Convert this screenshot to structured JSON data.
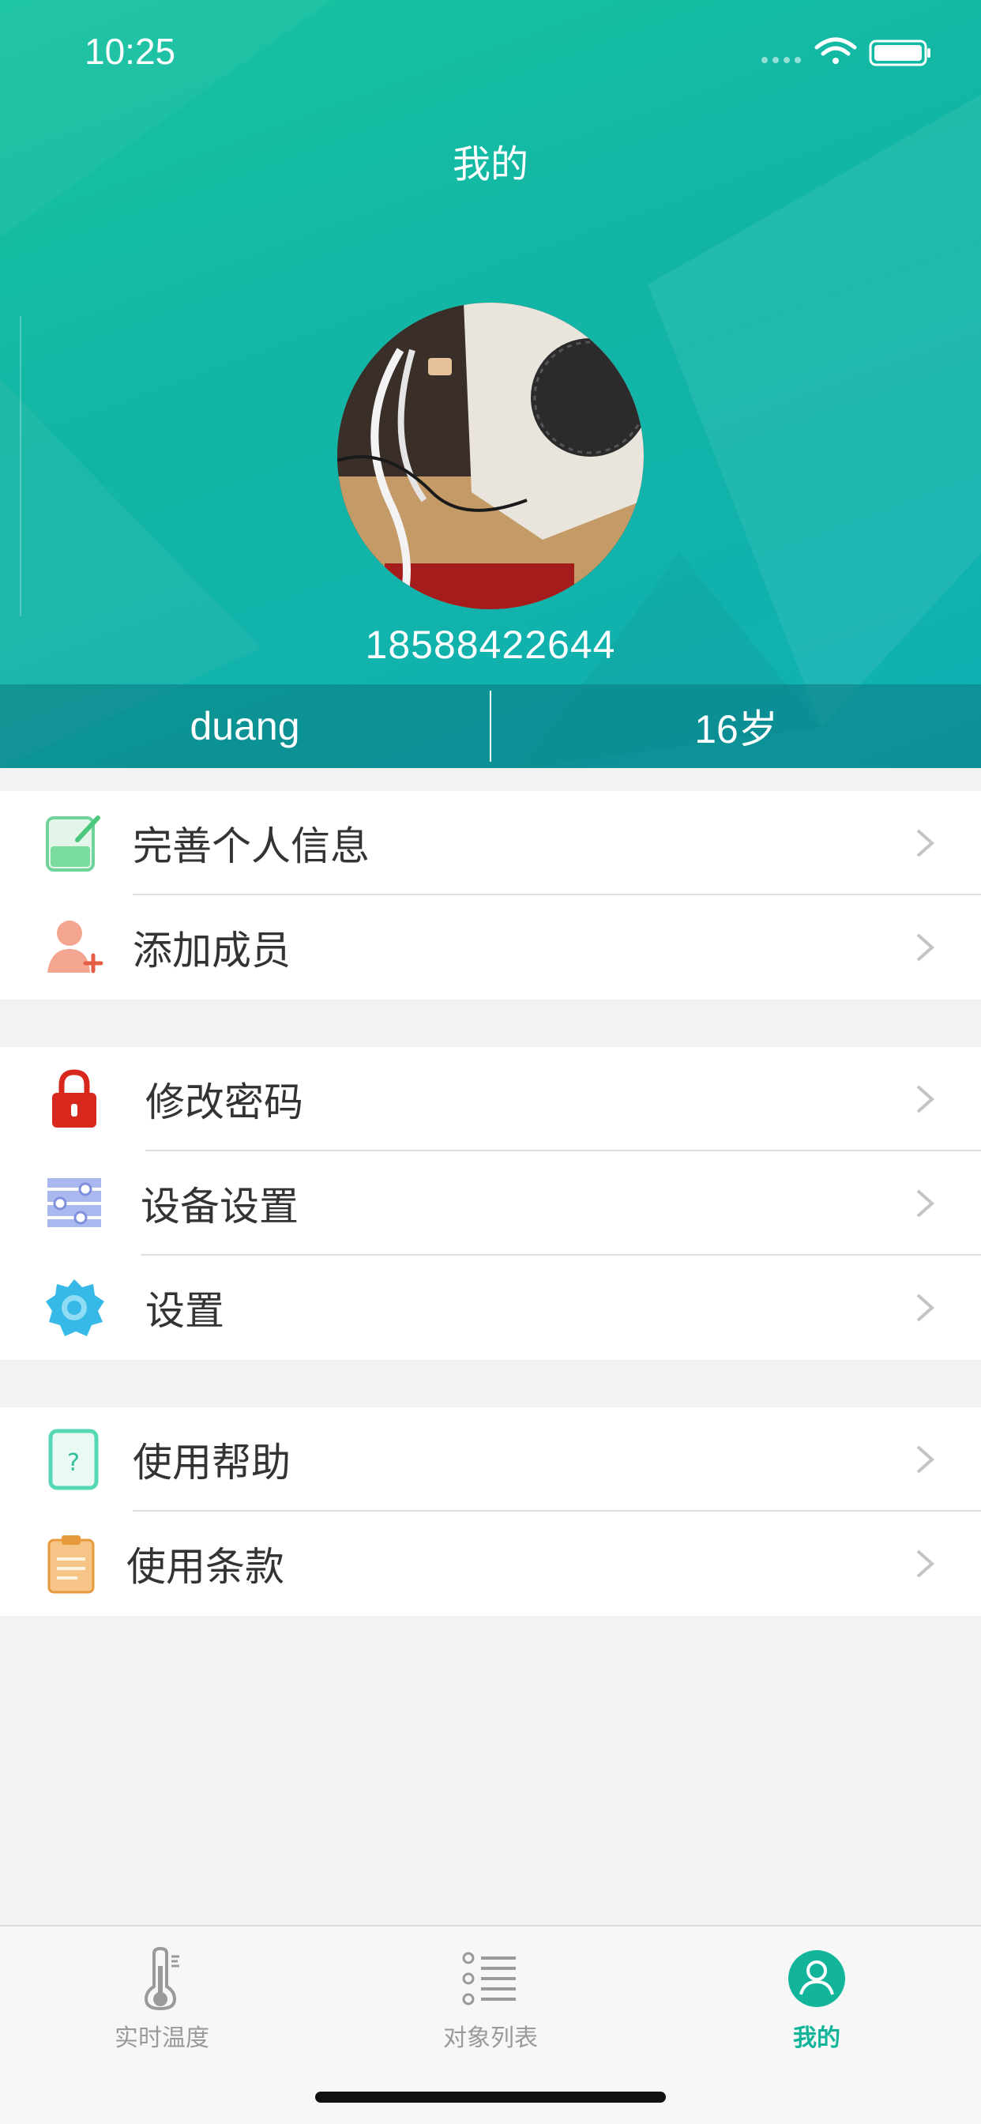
{
  "status_bar": {
    "time": "10:25"
  },
  "header": {
    "title": "我的",
    "phone": "18588422644",
    "name": "duang",
    "age": "16岁"
  },
  "menu_groups": [
    {
      "items": [
        {
          "label": "完善个人信息",
          "icon": "edit-note-icon"
        },
        {
          "label": "添加成员",
          "icon": "add-member-icon"
        }
      ]
    },
    {
      "items": [
        {
          "label": "修改密码",
          "icon": "lock-icon"
        },
        {
          "label": "设备设置",
          "icon": "device-settings-icon"
        },
        {
          "label": "设置",
          "icon": "gear-icon"
        }
      ]
    },
    {
      "items": [
        {
          "label": "使用帮助",
          "icon": "help-icon"
        },
        {
          "label": "使用条款",
          "icon": "clipboard-icon"
        }
      ]
    }
  ],
  "tabbar": {
    "tabs": [
      {
        "label": "实时温度",
        "icon": "thermometer-icon",
        "active": false
      },
      {
        "label": "对象列表",
        "icon": "list-icon",
        "active": false
      },
      {
        "label": "我的",
        "icon": "user-icon",
        "active": true
      }
    ]
  },
  "colors": {
    "accent": "#12b59a",
    "header_start": "#17c3a0",
    "header_end": "#10b0b4"
  }
}
